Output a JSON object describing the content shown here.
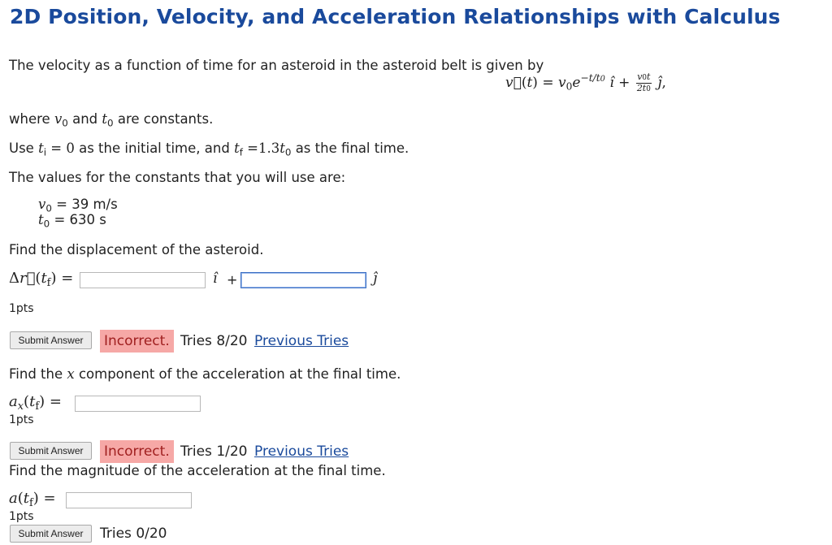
{
  "page": {
    "title": "2D Position, Velocity, and Acceleration Relationships with Calculus"
  },
  "intro": {
    "line1": "The velocity as a function of time for an asteroid in the asteroid belt is given by",
    "where_prefix": "where",
    "where_and": "and",
    "where_suffix": "are constants.",
    "use_prefix": "Use",
    "use_mid": "as the initial time, and",
    "use_eq": "=1.3",
    "use_suffix": "as the final time.",
    "values_line": "The values for the constants that you will use are:",
    "v0_value": "= 39 m/s",
    "t0_value": "= 630 s"
  },
  "q1": {
    "prompt": "Find the displacement of the asteroid.",
    "input_x_value": "",
    "input_y_value": "",
    "plus": "+",
    "points": "1pts",
    "submit_label": "Submit Answer",
    "status": "Incorrect.",
    "tries": "Tries 8/20",
    "prev_link": "Previous Tries"
  },
  "q2": {
    "prompt_pre": "Find the",
    "prompt_var": "x",
    "prompt_post": "component of the acceleration at the final time.",
    "input_value": "",
    "points": "1pts",
    "submit_label": "Submit Answer",
    "status": "Incorrect.",
    "tries": "Tries 1/20",
    "prev_link": "Previous Tries"
  },
  "q3": {
    "prompt": "Find the magnitude of the acceleration at the final time.",
    "input_value": "",
    "points": "1pts",
    "submit_label": "Submit Answer",
    "tries": "Tries 0/20"
  },
  "colors": {
    "title": "#1a4a9c",
    "incorrect_bg": "#f6a8a6",
    "link": "#1a4a9c"
  }
}
